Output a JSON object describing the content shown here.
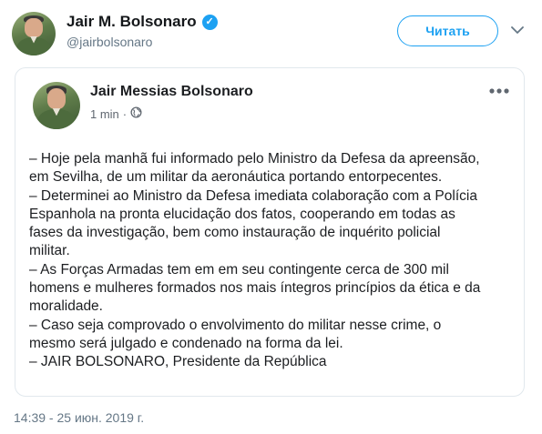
{
  "header": {
    "avatar_icon": "profile-photo-icon",
    "display_name": "Jair M. Bolsonaro",
    "verified_icon": "verified-badge-icon",
    "handle": "@jairbolsonaro",
    "follow_label": "Читать",
    "caret_icon": "chevron-down-icon"
  },
  "embedded_post": {
    "avatar_icon": "profile-photo-icon",
    "author": "Jair Messias Bolsonaro",
    "time_ago": "1 min",
    "separator": "·",
    "privacy_icon": "globe-icon",
    "more_icon": "more-options-icon",
    "lines": [
      "– Hoje pela manhã fui informado pelo Ministro da Defesa da apreensão,",
      "em Sevilha, de um militar da aeronáutica portando entorpecentes.",
      "– Determinei ao Ministro da Defesa imediata colaboração com a Polícia",
      "Espanhola na pronta elucidação dos fatos, cooperando em todas as",
      "fases da investigação, bem como instauração de inquérito policial",
      "militar.",
      "– As Forças Armadas tem em  em seu contingente  cerca de 300 mil",
      "homens e mulheres  formados nos mais íntegros princípios da ética e da",
      "moralidade.",
      "– Caso seja comprovado o envolvimento do militar nesse crime, o",
      "mesmo será julgado e condenado na forma da lei.",
      "– JAIR BOLSONARO, Presidente da República"
    ]
  },
  "timestamp": "14:39 - 25 июн. 2019 г.",
  "colors": {
    "accent": "#1da1f2",
    "text": "#14171a",
    "muted": "#657786",
    "card_border": "#e1e8ed"
  }
}
